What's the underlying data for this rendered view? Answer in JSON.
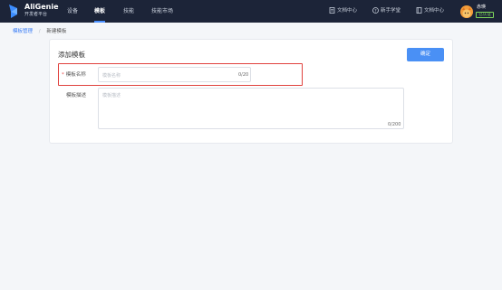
{
  "app": {
    "brand_name": "AliGenie",
    "brand_sub": "开发者平台"
  },
  "nav": {
    "items": [
      {
        "label": "设备",
        "active": false
      },
      {
        "label": "模板",
        "active": true
      },
      {
        "label": "技能",
        "active": false
      },
      {
        "label": "技能市场",
        "active": false
      }
    ],
    "right_links": [
      {
        "label": "文档中心",
        "icon": "doc-icon"
      },
      {
        "label": "新手学堂",
        "icon": "help-circle-icon"
      },
      {
        "label": "文档中心",
        "icon": "book-icon"
      }
    ],
    "user": {
      "name": "赤瑛",
      "badge": "已认证"
    }
  },
  "breadcrumb": {
    "parent": "模板管理",
    "separator": "/",
    "current": "新建模板"
  },
  "form": {
    "title": "添加模板",
    "confirm_label": "确定",
    "name": {
      "required_mark": "*",
      "label": "模板名称",
      "placeholder": "模板名称",
      "value": "",
      "counter": "0/20"
    },
    "description": {
      "label": "模板描述",
      "placeholder": "模板描述",
      "value": "",
      "counter": "0/200"
    }
  },
  "colors": {
    "topbar": "#1c2438",
    "accent": "#4a90f5",
    "highlight": "#e0413d",
    "badge": "#7fd85c"
  }
}
